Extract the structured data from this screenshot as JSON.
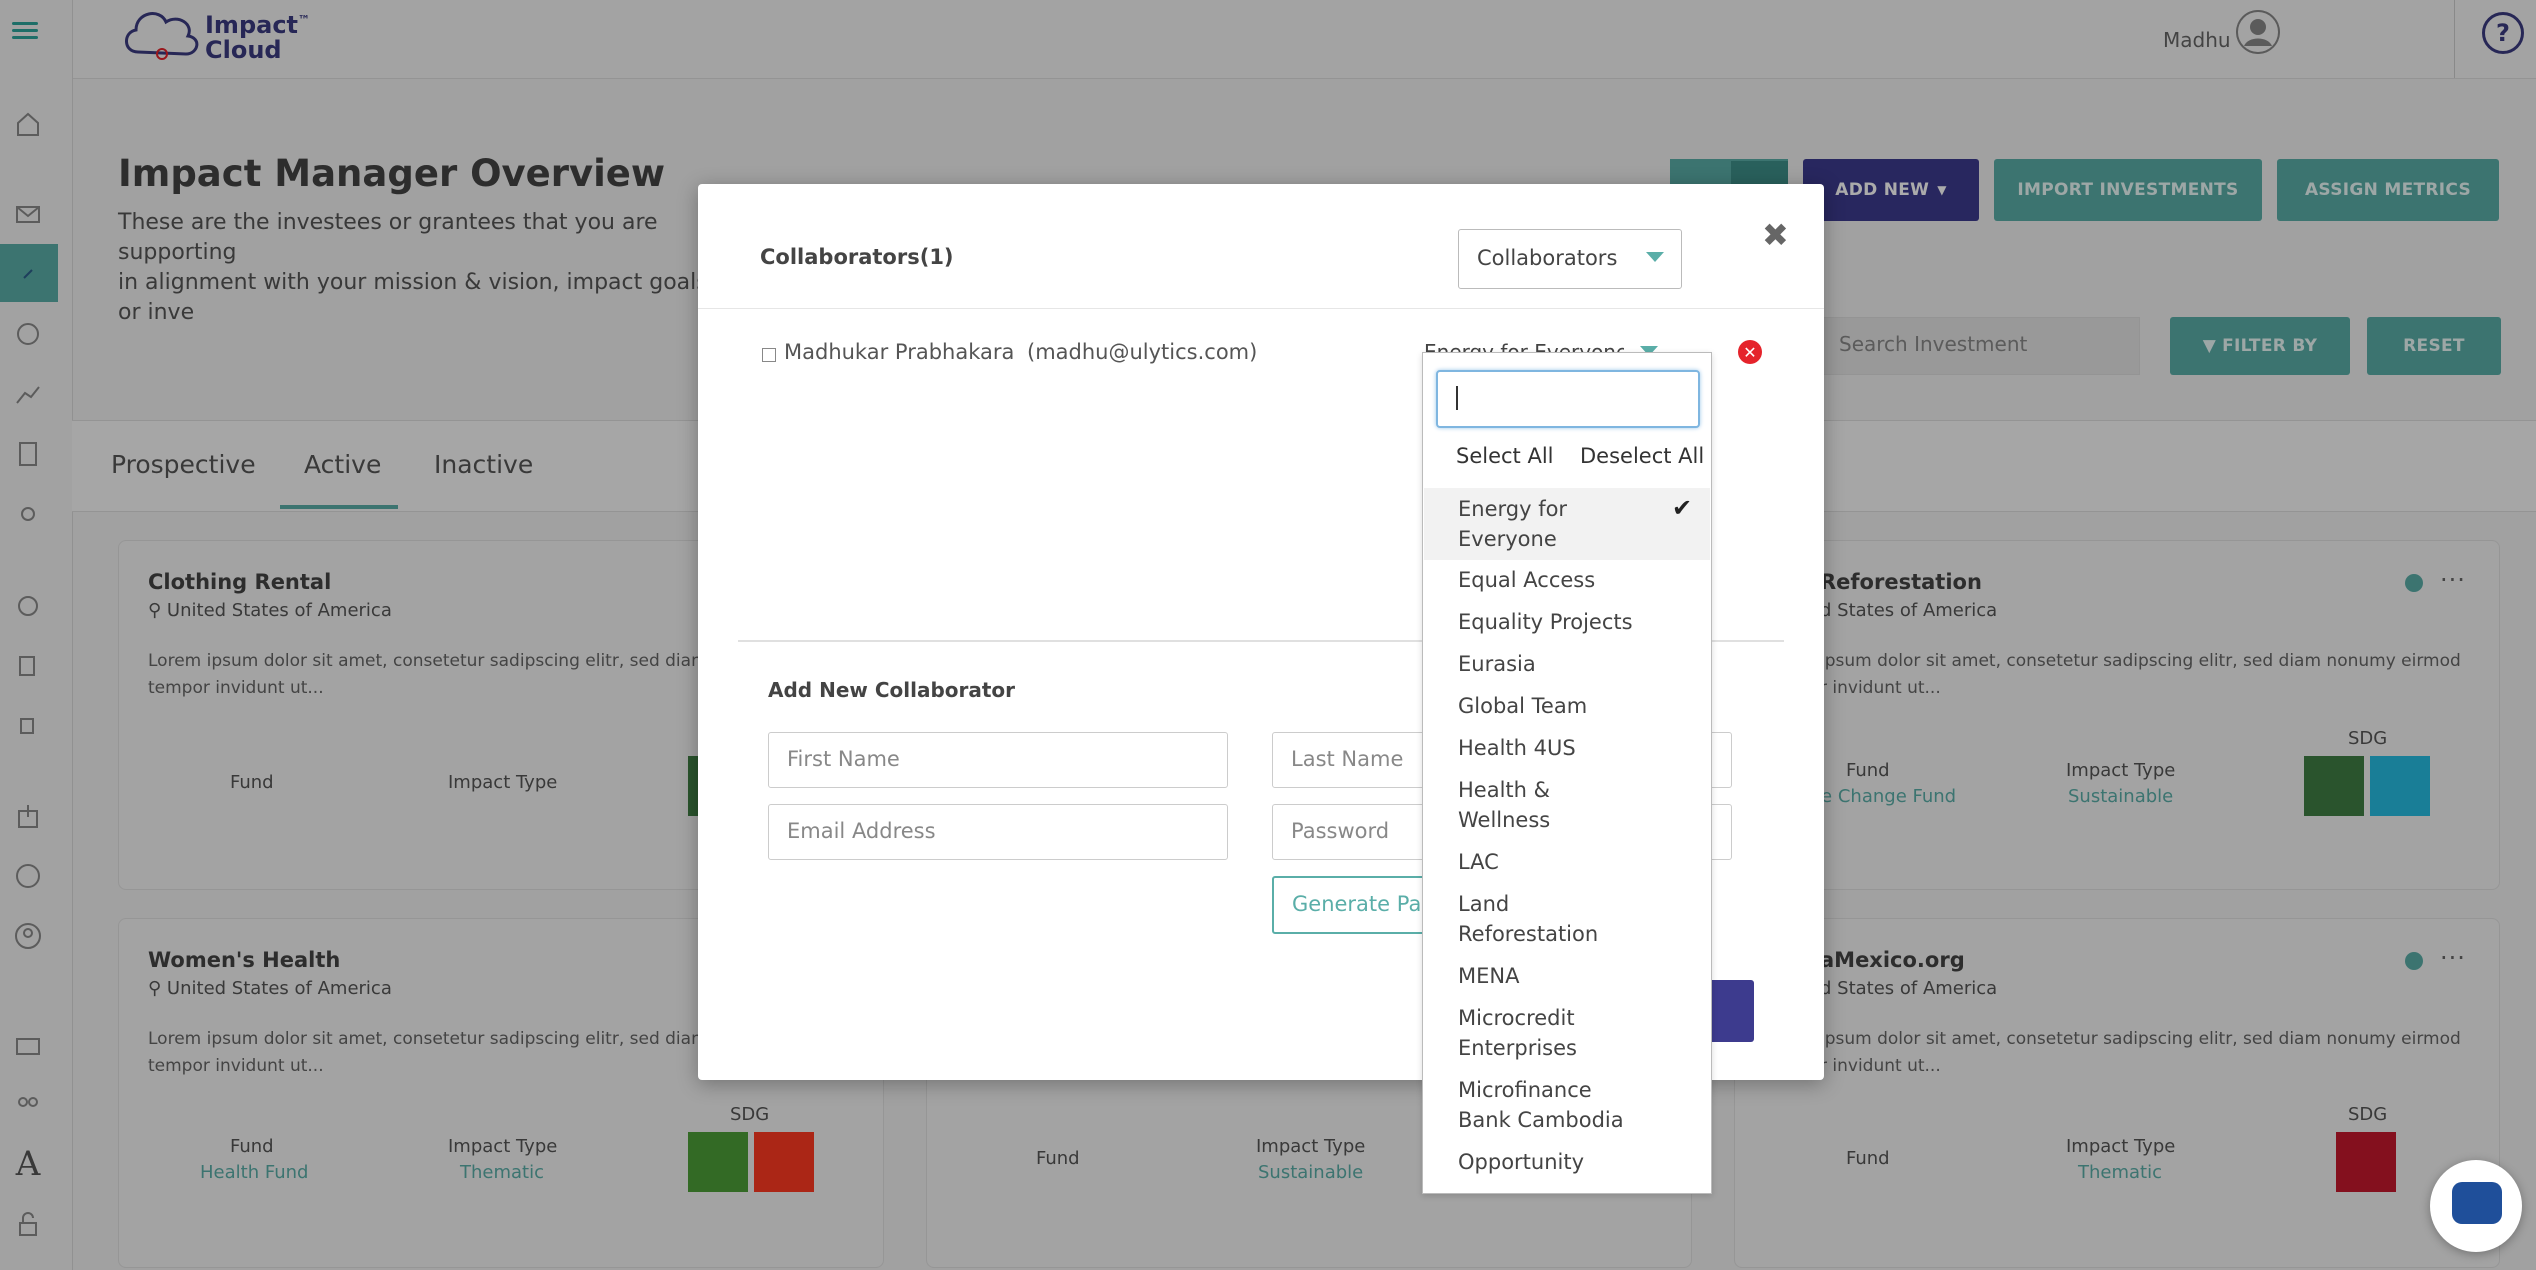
{
  "app": {
    "logo_line1": "Impact",
    "logo_line2": "Cloud",
    "logo_tm": "™"
  },
  "header": {
    "user_name": "Madhu",
    "help_label": "?"
  },
  "page": {
    "title": "Impact Manager Overview",
    "subtitle_line1": "These are the investees or grantees that you are supporting",
    "subtitle_line2": "in alignment with your mission & vision, impact goals or inve",
    "add_new": "ADD NEW",
    "import_investments": "IMPORT INVESTMENTS",
    "assign_metrics": "ASSIGN METRICS",
    "search_placeholder": "Search Investment",
    "filter_by": "FILTER BY",
    "reset": "RESET"
  },
  "tabs": [
    {
      "label": "Prospective"
    },
    {
      "label": "Active"
    },
    {
      "label": "Inactive"
    }
  ],
  "cards": [
    {
      "title": "Clothing Rental",
      "location": "United States of America",
      "desc1": "Lorem ipsum dolor sit amet, consetetur sadipscing elitr, sed diam n",
      "desc2": "tempor invidunt ut...",
      "fund_label": "Fund",
      "impact_label": "Impact Type"
    },
    {
      "title": "Women's Health",
      "location": "United States of America",
      "desc1": "Lorem ipsum dolor sit amet, consetetur sadipscing elitr, sed diam n",
      "desc2": "tempor invidunt ut...",
      "fund_label": "Fund",
      "fund_value": "Health Fund",
      "impact_label": "Impact Type",
      "impact_value": "Thematic",
      "sdg_label": "SDG"
    },
    {
      "fund_label": "Fund",
      "impact_label": "Impact Type",
      "impact_value": "Sustainable"
    },
    {
      "title": "Reforestation",
      "location": "d States of America",
      "desc1": "ipsum dolor sit amet, consetetur sadipscing elitr, sed diam nonumy eirmod",
      "desc2": "r invidunt ut...",
      "fund_label": "Fund",
      "fund_value": "te Change Fund",
      "impact_label": "Impact Type",
      "impact_value": "Sustainable",
      "sdg_label": "SDG"
    },
    {
      "title": "aMexico.org",
      "location": "d States of America",
      "desc1": "ipsum dolor sit amet, consetetur sadipscing elitr, sed diam nonumy eirmod",
      "desc2": "r invidunt ut...",
      "fund_label": "Fund",
      "impact_label": "Impact Type",
      "impact_value": "Thematic",
      "sdg_label": "SDG"
    }
  ],
  "modal": {
    "title": "Collaborators(1)",
    "close": "✖",
    "role_select": "Collaborators",
    "collaborator": {
      "name": "Madhukar Prabhakara",
      "email": "(madhu@ulytics.com)",
      "projects": "Energy for Everyone"
    },
    "add_title": "Add New Collaborator",
    "first_name_placeholder": "First Name",
    "last_name_placeholder": "Last Name",
    "email_placeholder": "Email Address",
    "password_placeholder": "Password",
    "generate_password": "Generate Pas"
  },
  "dropdown": {
    "select_all": "Select All",
    "deselect_all": "Deselect All",
    "items": [
      {
        "line1": "Energy for",
        "line2": "Everyone",
        "selected": true
      },
      {
        "line1": "Equal Access"
      },
      {
        "line1": "Equality Projects"
      },
      {
        "line1": "Eurasia"
      },
      {
        "line1": "Global Team"
      },
      {
        "line1": "Health 4US"
      },
      {
        "line1": "Health &",
        "line2": "Wellness"
      },
      {
        "line1": "LAC"
      },
      {
        "line1": "Land",
        "line2": "Reforestation"
      },
      {
        "line1": "MENA"
      },
      {
        "line1": "Microcredit",
        "line2": "Enterprises"
      },
      {
        "line1": "Microfinance",
        "line2": "Bank Cambodia"
      },
      {
        "line1": "Opportunity"
      }
    ],
    "check_mark": "✔"
  },
  "colors": {
    "teal": "#5aaea8",
    "indigo": "#3d3b8e",
    "danger": "#e5232b"
  }
}
